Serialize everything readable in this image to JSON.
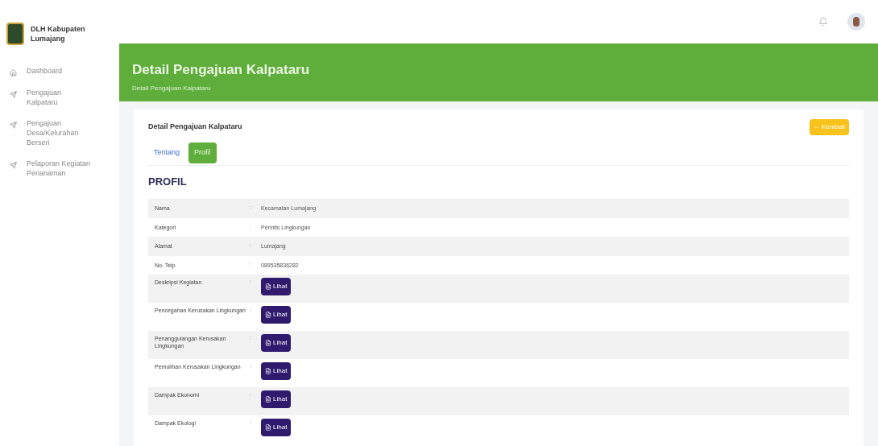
{
  "brand": {
    "name": "DLH Kabupaten Lumajang"
  },
  "sidebar": {
    "items": [
      {
        "label": "Dashboard",
        "kind": "home",
        "selected": false
      },
      {
        "label": "Pengajuan Kalpataru",
        "kind": "send",
        "selected": false
      },
      {
        "label": "Pengajuan Desa/Kelurahan Berseri",
        "kind": "send",
        "selected": false
      },
      {
        "label": "Pelaporan Kegiatan Penanaman",
        "kind": "send",
        "selected": false
      }
    ]
  },
  "header": {
    "title": "Detail Pengajuan Kalpataru",
    "breadcrumb": "Detail Pengajuan Kalpataru"
  },
  "card": {
    "title": "Detail Pengajuan Kalpataru",
    "back_button": "← Kembali",
    "tabs": [
      {
        "label": "Tentang",
        "selected": false
      },
      {
        "label": "Profil",
        "selected": true
      }
    ],
    "section_title": "PROFIL",
    "rows": [
      {
        "label": "Nama",
        "separator": ":",
        "kind": "text",
        "value": "Kecamatan Lumajang"
      },
      {
        "label": "Kategori",
        "separator": ":",
        "kind": "text",
        "value": "Perintis Lingkungan"
      },
      {
        "label": "Alamat",
        "separator": ":",
        "kind": "text",
        "value": "Lumajang"
      },
      {
        "label": "No. Telp",
        "separator": ":",
        "kind": "text",
        "value": "089535836282"
      },
      {
        "label": "Deskripsi Kegiatan",
        "separator": ":",
        "kind": "file",
        "value": "Lihat"
      },
      {
        "label": "Pencegahan Kerusakan Lingkungan",
        "separator": ":",
        "kind": "file",
        "value": "Lihat"
      },
      {
        "label": "Penanggulangan Kerusakan Lingkungan",
        "separator": ":",
        "kind": "file",
        "value": "Lihat"
      },
      {
        "label": "Pemulihan Kerusakan Lingkungan",
        "separator": ":",
        "kind": "file",
        "value": "Lihat"
      },
      {
        "label": "Dampak Ekonomi",
        "separator": ":",
        "kind": "file",
        "value": "Lihat"
      },
      {
        "label": "Dampak Ekologi",
        "separator": ":",
        "kind": "file",
        "value": "Lihat"
      }
    ]
  }
}
